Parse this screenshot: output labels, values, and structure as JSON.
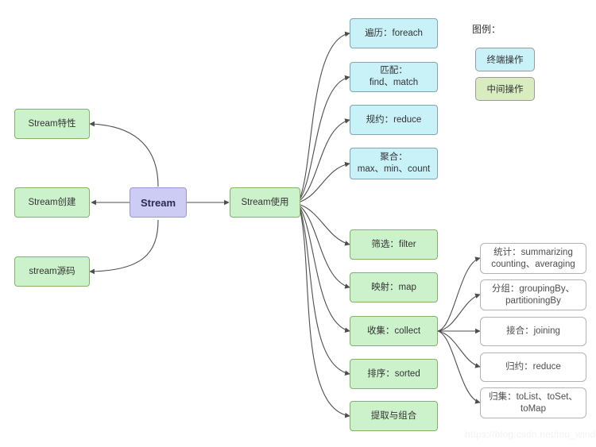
{
  "diagram": {
    "root": {
      "label": "Stream"
    },
    "left_branches": [
      {
        "label": "Stream特性"
      },
      {
        "label": "Stream创建"
      },
      {
        "label": "stream源码"
      }
    ],
    "usage": {
      "label": "Stream使用"
    },
    "terminal_ops": [
      {
        "label": "遍历：foreach"
      },
      {
        "label": "匹配：\nfind、match"
      },
      {
        "label": "规约：reduce"
      },
      {
        "label": "聚合：\nmax、min、count"
      }
    ],
    "intermediate_ops": [
      {
        "label": "筛选：filter"
      },
      {
        "label": "映射：map"
      },
      {
        "label": "收集：collect"
      },
      {
        "label": "排序：sorted"
      },
      {
        "label": "提取与组合"
      }
    ],
    "collect_children": [
      {
        "label": "统计：summarizing\ncounting、averaging"
      },
      {
        "label": "分组：groupingBy、\npartitioningBy"
      },
      {
        "label": "接合：joining"
      },
      {
        "label": "归约：reduce"
      },
      {
        "label": "归集：toList、toSet、\ntoMap"
      }
    ]
  },
  "legend": {
    "title": "图例：",
    "items": [
      {
        "label": "终端操作",
        "color": "#c8f2f7"
      },
      {
        "label": "中间操作",
        "color": "#d9ecc0"
      }
    ]
  },
  "watermark": {
    "text": "https://blog.csdn.net/mu_wind"
  },
  "colors": {
    "green_fill": "#ccf2cc",
    "green_stroke": "#82b366",
    "cyan_fill": "#c8f2f7",
    "cyan_stroke": "#7ea6b3",
    "purple_fill": "#ccccf5",
    "purple_stroke": "#9999d6",
    "edge_stroke": "#4d4d4d",
    "plain_stroke": "#b3b3b3",
    "background": "#ffffff"
  }
}
